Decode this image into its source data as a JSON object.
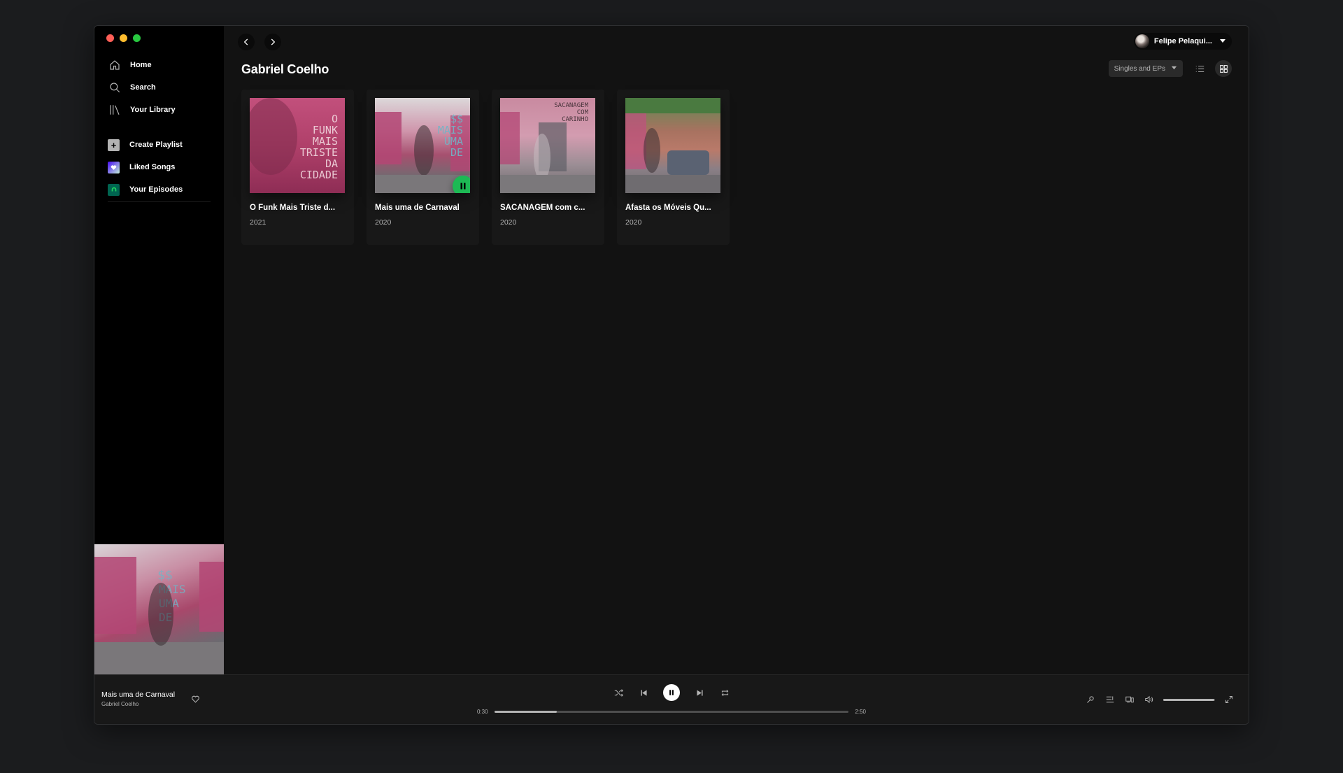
{
  "sidebar": {
    "nav": [
      {
        "label": "Home",
        "icon": "home-icon"
      },
      {
        "label": "Search",
        "icon": "search-icon"
      },
      {
        "label": "Your Library",
        "icon": "library-icon"
      }
    ],
    "playlists": [
      {
        "label": "Create Playlist",
        "icon": "plus-icon"
      },
      {
        "label": "Liked Songs",
        "icon": "heart-icon"
      },
      {
        "label": "Your Episodes",
        "icon": "podcast-icon"
      }
    ]
  },
  "header": {
    "user_name": "Felipe Pelaqui...",
    "page_title": "Gabriel Coelho",
    "filter_label": "Singles and EPs"
  },
  "albums": [
    {
      "title": "O Funk Mais Triste d...",
      "year": "2021",
      "cover_text": "O FUNK MAIS TRISTE DA CIDADE"
    },
    {
      "title": "Mais uma de Carnaval",
      "year": "2020",
      "cover_text": "$$ MAIS UMA DE"
    },
    {
      "title": "SACANAGEM com c...",
      "year": "2020",
      "cover_text": "SACANAGEM COM CARINHO"
    },
    {
      "title": "Afasta os Móveis Qu...",
      "year": "2020",
      "cover_text": ""
    }
  ],
  "player": {
    "track_title": "Mais uma de Carnaval",
    "track_artist": "Gabriel Coelho",
    "elapsed": "0:30",
    "duration": "2:50",
    "progress_fraction": 0.176,
    "volume_fraction": 0.98
  },
  "colors": {
    "accent": "#1db954",
    "background": "#121212",
    "sidebar": "#000000"
  }
}
